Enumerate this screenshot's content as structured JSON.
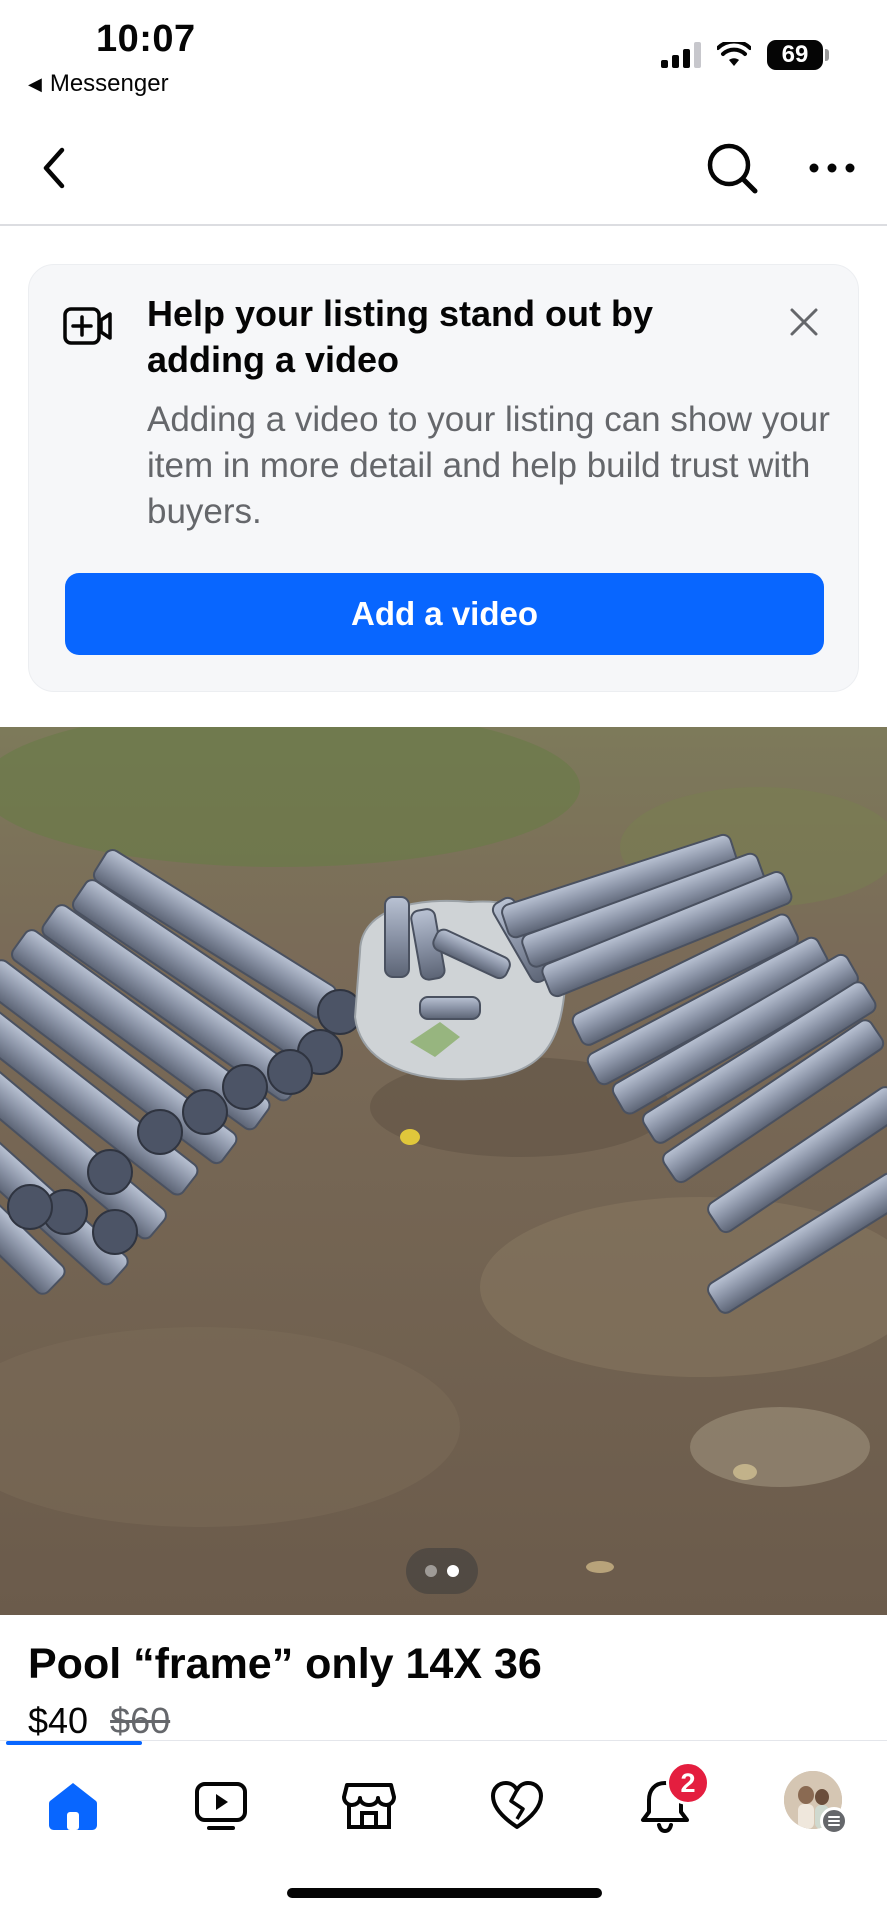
{
  "status_bar": {
    "time": "10:07",
    "back_app": "Messenger",
    "battery": "69"
  },
  "nav": {
    "back_icon": "chevron-left-icon",
    "search_icon": "search-icon",
    "more_icon": "more-horizontal-icon"
  },
  "promo": {
    "title": "Help your listing stand out by adding a video",
    "body": "Adding a video to your listing can show your item in more detail and help build trust with buyers.",
    "button_label": "Add a video",
    "icon": "add-video-icon",
    "close_icon": "close-icon",
    "accent_color": "#0866ff"
  },
  "photo": {
    "page_indicator": {
      "count": 2,
      "active": 2
    }
  },
  "listing": {
    "title": "Pool “frame” only 14X 36",
    "price": "$40",
    "original_price": "$60"
  },
  "tab_bar": {
    "tabs": [
      "home-icon",
      "video-icon",
      "marketplace-icon",
      "dating-icon",
      "notifications-icon",
      "profile-avatar"
    ],
    "active_tab": "home-icon",
    "notifications_badge": "2"
  }
}
